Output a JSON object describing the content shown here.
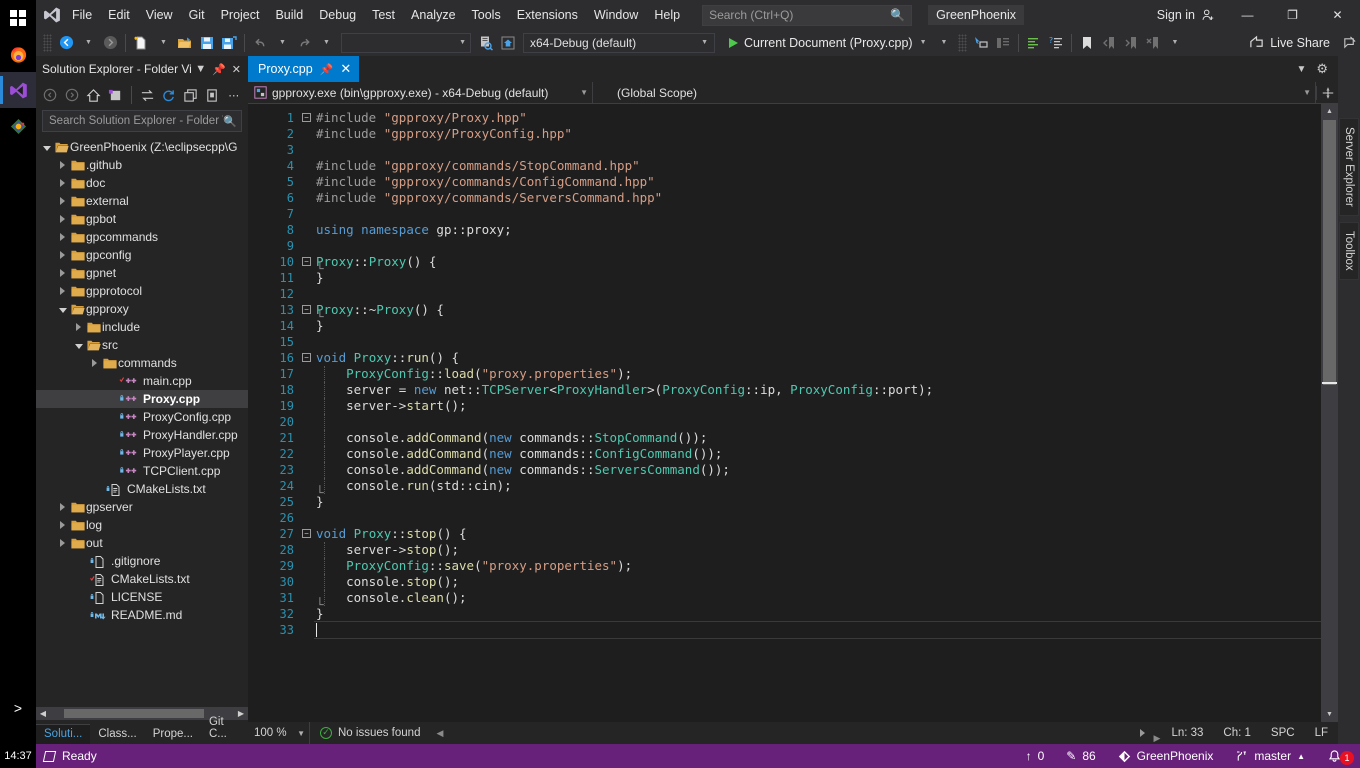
{
  "taskbar": {
    "items": [
      {
        "name": "start-button",
        "icon": "windows-logo-icon"
      },
      {
        "name": "firefox",
        "icon": "firefox-icon"
      },
      {
        "name": "visual-studio",
        "icon": "visual-studio-icon"
      },
      {
        "name": "unknown-app",
        "icon": "colored-app-icon"
      }
    ],
    "overflow_label": ">",
    "clock": "14:37"
  },
  "titlebar": {
    "menus": [
      "File",
      "Edit",
      "View",
      "Git",
      "Project",
      "Build",
      "Debug",
      "Test",
      "Analyze",
      "Tools",
      "Extensions",
      "Window",
      "Help"
    ],
    "search_placeholder": "Search (Ctrl+Q)",
    "project_name": "GreenPhoenix",
    "signin_label": "Sign in",
    "minimize": "—",
    "restore": "❐",
    "close": "✕"
  },
  "toolbar": {
    "navigate_back": "←",
    "navigate_forward": "→",
    "combo_blank_value": "",
    "config_value": "x64-Debug (default)",
    "run_label": "Current Document (Proxy.cpp)",
    "live_share_label": "Live Share"
  },
  "sidebar": {
    "title": "Solution Explorer - Folder View",
    "search_placeholder": "Search Solution Explorer - Folder V",
    "tree": [
      {
        "label": "GreenPhoenix (Z:\\eclipsecpp\\G",
        "depth": 0,
        "state": "open",
        "icon": "folder-open-icon",
        "selected": false
      },
      {
        "label": ".github",
        "depth": 1,
        "state": "closed",
        "icon": "folder-icon",
        "selected": false
      },
      {
        "label": "doc",
        "depth": 1,
        "state": "closed",
        "icon": "folder-icon",
        "selected": false
      },
      {
        "label": "external",
        "depth": 1,
        "state": "closed",
        "icon": "folder-icon",
        "selected": false
      },
      {
        "label": "gpbot",
        "depth": 1,
        "state": "closed",
        "icon": "folder-icon",
        "selected": false
      },
      {
        "label": "gpcommands",
        "depth": 1,
        "state": "closed",
        "icon": "folder-icon",
        "selected": false
      },
      {
        "label": "gpconfig",
        "depth": 1,
        "state": "closed",
        "icon": "folder-icon",
        "selected": false
      },
      {
        "label": "gpnet",
        "depth": 1,
        "state": "closed",
        "icon": "folder-icon",
        "selected": false
      },
      {
        "label": "gpprotocol",
        "depth": 1,
        "state": "closed",
        "icon": "folder-icon",
        "selected": false
      },
      {
        "label": "gpproxy",
        "depth": 1,
        "state": "open",
        "icon": "folder-open-icon",
        "selected": false
      },
      {
        "label": "include",
        "depth": 2,
        "state": "closed",
        "icon": "folder-icon",
        "selected": false
      },
      {
        "label": "src",
        "depth": 2,
        "state": "open",
        "icon": "folder-open-icon",
        "selected": false
      },
      {
        "label": "commands",
        "depth": 3,
        "state": "closed",
        "icon": "folder-icon",
        "selected": false
      },
      {
        "label": "main.cpp",
        "depth": 4,
        "state": "leaf",
        "icon": "cpp-file-modified-icon",
        "selected": false
      },
      {
        "label": "Proxy.cpp",
        "depth": 4,
        "state": "leaf",
        "icon": "cpp-file-locked-icon",
        "selected": true
      },
      {
        "label": "ProxyConfig.cpp",
        "depth": 4,
        "state": "leaf",
        "icon": "cpp-file-locked-icon",
        "selected": false
      },
      {
        "label": "ProxyHandler.cpp",
        "depth": 4,
        "state": "leaf",
        "icon": "cpp-file-locked-icon",
        "selected": false
      },
      {
        "label": "ProxyPlayer.cpp",
        "depth": 4,
        "state": "leaf",
        "icon": "cpp-file-locked-icon",
        "selected": false
      },
      {
        "label": "TCPClient.cpp",
        "depth": 4,
        "state": "leaf",
        "icon": "cpp-file-locked-icon",
        "selected": false
      },
      {
        "label": "CMakeLists.txt",
        "depth": 3,
        "state": "leaf",
        "icon": "txt-file-locked-icon",
        "selected": false
      },
      {
        "label": "gpserver",
        "depth": 1,
        "state": "closed",
        "icon": "folder-icon",
        "selected": false
      },
      {
        "label": "log",
        "depth": 1,
        "state": "closed",
        "icon": "folder-icon",
        "selected": false
      },
      {
        "label": "out",
        "depth": 1,
        "state": "closed",
        "icon": "folder-icon",
        "selected": false
      },
      {
        "label": ".gitignore",
        "depth": 2,
        "state": "leaf",
        "icon": "file-locked-icon",
        "selected": false
      },
      {
        "label": "CMakeLists.txt",
        "depth": 2,
        "state": "leaf",
        "icon": "txt-file-modified-icon",
        "selected": false
      },
      {
        "label": "LICENSE",
        "depth": 2,
        "state": "leaf",
        "icon": "file-locked-icon",
        "selected": false
      },
      {
        "label": "README.md",
        "depth": 2,
        "state": "leaf",
        "icon": "md-file-icon",
        "selected": false
      }
    ],
    "tabs": [
      {
        "label": "Soluti...",
        "active": true
      },
      {
        "label": "Class...",
        "active": false
      },
      {
        "label": "Prope...",
        "active": false
      },
      {
        "label": "Git C...",
        "active": false
      }
    ]
  },
  "editor": {
    "tab_label": "Proxy.cpp",
    "navbar": {
      "project": "gpproxy.exe (bin\\gpproxy.exe) - x64-Debug (default)",
      "scope": "(Global Scope)"
    },
    "lines": [
      {
        "n": 1,
        "fold": "minus",
        "text": "#include \"gpproxy/Proxy.hpp\""
      },
      {
        "n": 2,
        "fold": "",
        "text": "#include \"gpproxy/ProxyConfig.hpp\""
      },
      {
        "n": 3,
        "fold": "",
        "text": ""
      },
      {
        "n": 4,
        "fold": "",
        "text": "#include \"gpproxy/commands/StopCommand.hpp\""
      },
      {
        "n": 5,
        "fold": "",
        "text": "#include \"gpproxy/commands/ConfigCommand.hpp\""
      },
      {
        "n": 6,
        "fold": "",
        "text": "#include \"gpproxy/commands/ServersCommand.hpp\""
      },
      {
        "n": 7,
        "fold": "",
        "text": ""
      },
      {
        "n": 8,
        "fold": "",
        "text": "using namespace gp::proxy;"
      },
      {
        "n": 9,
        "fold": "",
        "text": ""
      },
      {
        "n": 10,
        "fold": "minus",
        "text": "Proxy::Proxy() {"
      },
      {
        "n": 11,
        "fold": "",
        "text": "}"
      },
      {
        "n": 12,
        "fold": "",
        "text": ""
      },
      {
        "n": 13,
        "fold": "minus",
        "text": "Proxy::~Proxy() {"
      },
      {
        "n": 14,
        "fold": "",
        "text": "}"
      },
      {
        "n": 15,
        "fold": "",
        "text": ""
      },
      {
        "n": 16,
        "fold": "minus",
        "text": "void Proxy::run() {"
      },
      {
        "n": 17,
        "fold": "",
        "text": "    ProxyConfig::load(\"proxy.properties\");"
      },
      {
        "n": 18,
        "fold": "",
        "text": "    server = new net::TCPServer<ProxyHandler>(ProxyConfig::ip, ProxyConfig::port);"
      },
      {
        "n": 19,
        "fold": "",
        "text": "    server->start();"
      },
      {
        "n": 20,
        "fold": "",
        "text": ""
      },
      {
        "n": 21,
        "fold": "",
        "text": "    console.addCommand(new commands::StopCommand());"
      },
      {
        "n": 22,
        "fold": "",
        "text": "    console.addCommand(new commands::ConfigCommand());"
      },
      {
        "n": 23,
        "fold": "",
        "text": "    console.addCommand(new commands::ServersCommand());"
      },
      {
        "n": 24,
        "fold": "",
        "text": "    console.run(std::cin);"
      },
      {
        "n": 25,
        "fold": "",
        "text": "}"
      },
      {
        "n": 26,
        "fold": "",
        "text": ""
      },
      {
        "n": 27,
        "fold": "minus",
        "text": "void Proxy::stop() {"
      },
      {
        "n": 28,
        "fold": "",
        "text": "    server->stop();"
      },
      {
        "n": 29,
        "fold": "",
        "text": "    ProxyConfig::save(\"proxy.properties\");"
      },
      {
        "n": 30,
        "fold": "",
        "text": "    console.stop();"
      },
      {
        "n": 31,
        "fold": "",
        "text": "    console.clean();"
      },
      {
        "n": 32,
        "fold": "",
        "text": "}"
      },
      {
        "n": 33,
        "fold": "",
        "text": ""
      }
    ]
  },
  "rightdock": {
    "tabs": [
      "Server Explorer",
      "Toolbox"
    ]
  },
  "editorstatus": {
    "zoom": "100 %",
    "issues": "No issues found",
    "line": "Ln: 33",
    "col": "Ch: 1",
    "spaces": "SPC",
    "eol": "LF"
  },
  "statusbar": {
    "ready": "Ready",
    "outgoing": "0",
    "changes": "86",
    "repo": "GreenPhoenix",
    "branch": "master",
    "notifications": "1"
  },
  "colors": {
    "accent_blue": "#007acc",
    "status_purple": "#68217a",
    "chrome_dark": "#2d2d30",
    "editor_bg": "#1e1e1e",
    "panel_bg": "#252526",
    "linenum_blue": "#2b91af",
    "string_orange": "#d69d85",
    "keyword_blue": "#569cd6",
    "type_teal": "#4ec9b0",
    "badge_red": "#e81123"
  }
}
